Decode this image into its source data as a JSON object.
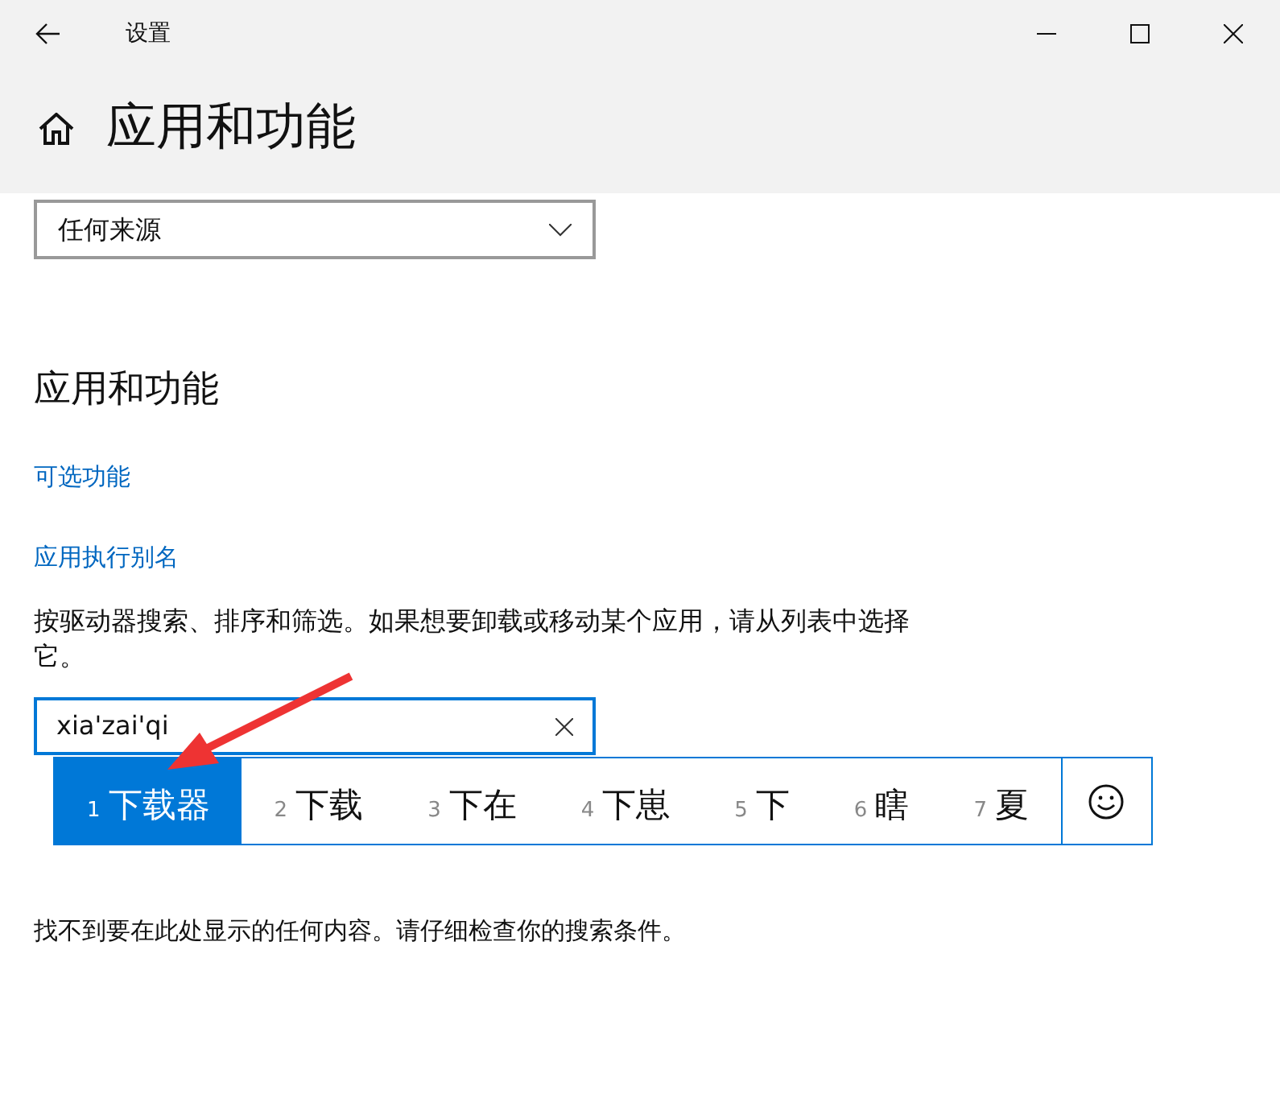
{
  "window": {
    "title": "设置"
  },
  "page": {
    "title": "应用和功能"
  },
  "filter_dropdown": {
    "value": "任何来源"
  },
  "section": {
    "title": "应用和功能",
    "links": [
      "可选功能",
      "应用执行别名"
    ],
    "description": "按驱动器搜索、排序和筛选。如果想要卸载或移动某个应用，请从列表中选择它。",
    "search": {
      "value": "xia'zai'qi"
    },
    "empty_message": "找不到要在此处显示的任何内容。请仔细检查你的搜索条件。"
  },
  "ime_candidates": [
    {
      "number": "1",
      "text": "下载器",
      "selected": true
    },
    {
      "number": "2",
      "text": "下载",
      "selected": false
    },
    {
      "number": "3",
      "text": "下在",
      "selected": false
    },
    {
      "number": "4",
      "text": "下崽",
      "selected": false
    },
    {
      "number": "5",
      "text": "下",
      "selected": false
    },
    {
      "number": "6",
      "text": "瞎",
      "selected": false
    },
    {
      "number": "7",
      "text": "夏",
      "selected": false
    }
  ]
}
